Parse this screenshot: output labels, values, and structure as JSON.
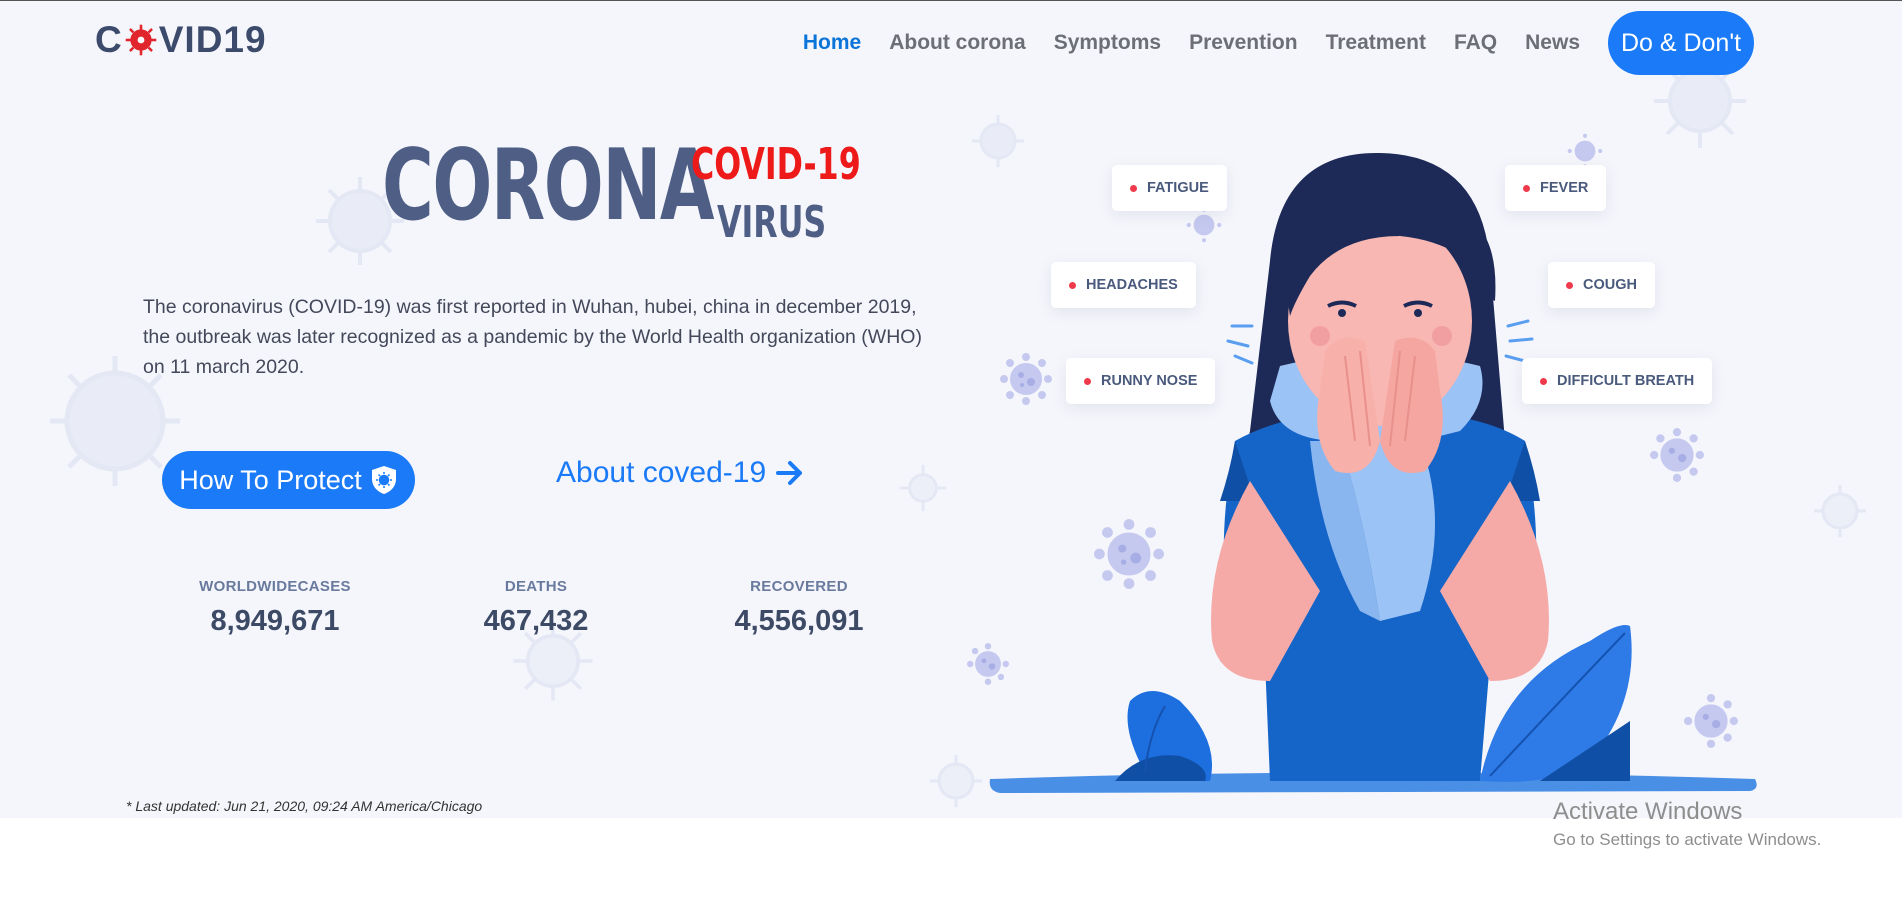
{
  "brand": {
    "logo_text_left": "C",
    "logo_text_right": "VID19",
    "logo_icon": "virus-o-icon"
  },
  "nav": {
    "items": [
      "Home",
      "About corona",
      "Symptoms",
      "Prevention",
      "Treatment",
      "FAQ",
      "News"
    ],
    "active": "Home",
    "cta": "Do & Don't"
  },
  "hero": {
    "title_main": "CORONA",
    "title_sup": "COVID-19",
    "title_sub": "VIRUS",
    "description": "The coronavirus (COVID-19) was first reported in Wuhan, hubei, china in december 2019, the outbreak was later recognized as a pandemic by the World Health organization (WHO) on 11 march 2020.",
    "protect_button": "How To Protect",
    "protect_icon": "shield-virus-icon",
    "about_link": "About coved-19",
    "about_icon": "arrow-right-icon"
  },
  "stats": [
    {
      "label": "WORLDWIDECASES",
      "value": "8,949,671"
    },
    {
      "label": "DEATHS",
      "value": "467,432"
    },
    {
      "label": "RECOVERED",
      "value": "4,556,091"
    }
  ],
  "last_updated": "* Last updated: Jun 21, 2020, 09:24 AM America/Chicago",
  "symptoms": [
    "FATIGUE",
    "FEVER",
    "HEADACHES",
    "COUGH",
    "RUNNY NOSE",
    "DIFFICULT BREATH"
  ],
  "colors": {
    "accent": "#1a7af7",
    "title": "#4e5e85",
    "alert": "#ee1a1a",
    "background": "#f5f6fb"
  },
  "watermark": {
    "line1": "Activate Windows",
    "line2": "Go to Settings to activate Windows."
  }
}
